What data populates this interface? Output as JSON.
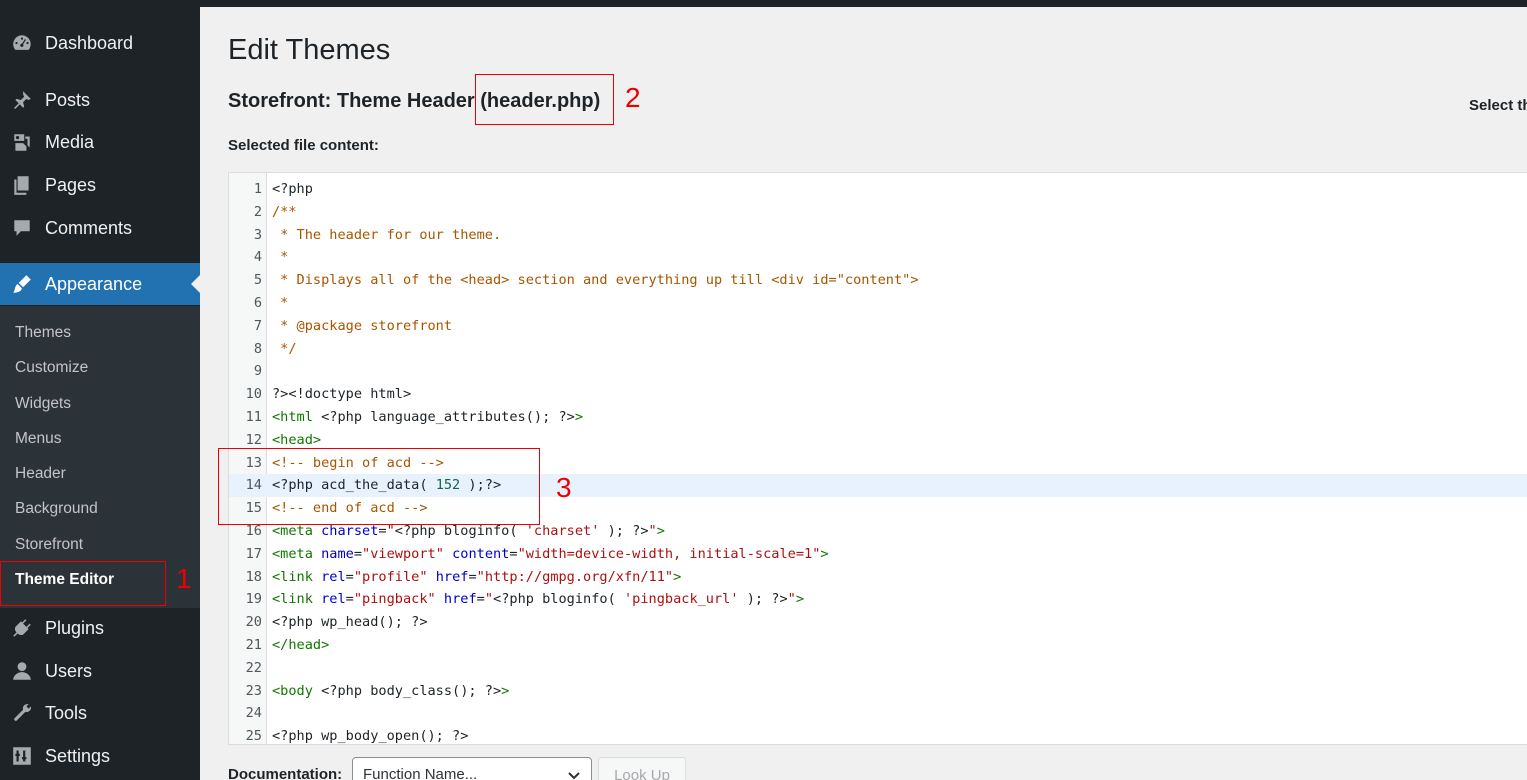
{
  "sidebar": {
    "items": [
      {
        "label": "Dashboard",
        "icon": "dashboard-icon"
      },
      {
        "label": "Posts",
        "icon": "pushpin-icon"
      },
      {
        "label": "Media",
        "icon": "media-icon"
      },
      {
        "label": "Pages",
        "icon": "pages-icon"
      },
      {
        "label": "Comments",
        "icon": "comment-icon"
      },
      {
        "label": "Appearance",
        "icon": "paintbrush-icon"
      },
      {
        "label": "Plugins",
        "icon": "plugin-icon"
      },
      {
        "label": "Users",
        "icon": "user-icon"
      },
      {
        "label": "Tools",
        "icon": "wrench-icon"
      },
      {
        "label": "Settings",
        "icon": "settings-icon"
      }
    ],
    "submenu": [
      "Themes",
      "Customize",
      "Widgets",
      "Menus",
      "Header",
      "Background",
      "Storefront",
      "Theme Editor"
    ]
  },
  "annotations": {
    "one": "1",
    "two": "2",
    "three": "3"
  },
  "main": {
    "page_title": "Edit Themes",
    "file_title": "Storefront: Theme Header (header.php)",
    "select_theme_label": "Select th",
    "selected_file_label": "Selected file content:",
    "doc_label": "Documentation:",
    "doc_select_value": "Function Name...",
    "lookup_label": "Look Up"
  },
  "code_lines": [
    {
      "n": "1",
      "tokens": [
        [
          "def",
          "<?php"
        ]
      ]
    },
    {
      "n": "2",
      "tokens": [
        [
          "cmt",
          "/**"
        ]
      ]
    },
    {
      "n": "3",
      "tokens": [
        [
          "cmt",
          " * The header for our theme."
        ]
      ]
    },
    {
      "n": "4",
      "tokens": [
        [
          "cmt",
          " *"
        ]
      ]
    },
    {
      "n": "5",
      "tokens": [
        [
          "cmt",
          " * Displays all of the <head> section and everything up till <div id=\"content\">"
        ]
      ]
    },
    {
      "n": "6",
      "tokens": [
        [
          "cmt",
          " *"
        ]
      ]
    },
    {
      "n": "7",
      "tokens": [
        [
          "cmt",
          " * @package storefront"
        ]
      ]
    },
    {
      "n": "8",
      "tokens": [
        [
          "cmt",
          " */"
        ]
      ]
    },
    {
      "n": "9",
      "tokens": [
        [
          "def",
          ""
        ]
      ]
    },
    {
      "n": "10",
      "tokens": [
        [
          "def",
          "?><!doctype html>"
        ]
      ]
    },
    {
      "n": "11",
      "tokens": [
        [
          "tag",
          "<html "
        ],
        [
          "def",
          "<?php language_attributes(); ?>"
        ],
        [
          "tag",
          ">"
        ]
      ]
    },
    {
      "n": "12",
      "tokens": [
        [
          "tag",
          "<head>"
        ]
      ]
    },
    {
      "n": "13",
      "tokens": [
        [
          "cmt",
          "<!-- begin of acd -->"
        ]
      ]
    },
    {
      "n": "14",
      "tokens": [
        [
          "def",
          "<?php acd_the_data( "
        ],
        [
          "num",
          "152"
        ],
        [
          "def",
          " );?>"
        ]
      ]
    },
    {
      "n": "15",
      "tokens": [
        [
          "cmt",
          "<!-- end of acd -->"
        ]
      ]
    },
    {
      "n": "16",
      "tokens": [
        [
          "tag",
          "<meta "
        ],
        [
          "attr",
          "charset"
        ],
        [
          "def",
          "="
        ],
        [
          "str",
          "\""
        ],
        [
          "def",
          "<?php bloginfo( "
        ],
        [
          "str",
          "'charset'"
        ],
        [
          "def",
          " ); ?>"
        ],
        [
          "str",
          "\""
        ],
        [
          "tag",
          ">"
        ]
      ]
    },
    {
      "n": "17",
      "tokens": [
        [
          "tag",
          "<meta "
        ],
        [
          "attr",
          "name"
        ],
        [
          "def",
          "="
        ],
        [
          "str",
          "\"viewport\""
        ],
        [
          "def",
          " "
        ],
        [
          "attr",
          "content"
        ],
        [
          "def",
          "="
        ],
        [
          "str",
          "\"width=device-width, initial-scale=1\""
        ],
        [
          "tag",
          ">"
        ]
      ]
    },
    {
      "n": "18",
      "tokens": [
        [
          "tag",
          "<link "
        ],
        [
          "attr",
          "rel"
        ],
        [
          "def",
          "="
        ],
        [
          "str",
          "\"profile\""
        ],
        [
          "def",
          " "
        ],
        [
          "attr",
          "href"
        ],
        [
          "def",
          "="
        ],
        [
          "str",
          "\"http://gmpg.org/xfn/11\""
        ],
        [
          "tag",
          ">"
        ]
      ]
    },
    {
      "n": "19",
      "tokens": [
        [
          "tag",
          "<link "
        ],
        [
          "attr",
          "rel"
        ],
        [
          "def",
          "="
        ],
        [
          "str",
          "\"pingback\""
        ],
        [
          "def",
          " "
        ],
        [
          "attr",
          "href"
        ],
        [
          "def",
          "="
        ],
        [
          "str",
          "\""
        ],
        [
          "def",
          "<?php bloginfo( "
        ],
        [
          "str",
          "'pingback_url'"
        ],
        [
          "def",
          " ); ?>"
        ],
        [
          "str",
          "\""
        ],
        [
          "tag",
          ">"
        ]
      ]
    },
    {
      "n": "20",
      "tokens": [
        [
          "def",
          "<?php wp_head(); ?>"
        ]
      ]
    },
    {
      "n": "21",
      "tokens": [
        [
          "tag",
          "</head>"
        ]
      ]
    },
    {
      "n": "22",
      "tokens": [
        [
          "def",
          ""
        ]
      ]
    },
    {
      "n": "23",
      "tokens": [
        [
          "tag",
          "<body "
        ],
        [
          "def",
          "<?php body_class(); ?>"
        ],
        [
          "tag",
          ">"
        ]
      ]
    },
    {
      "n": "24",
      "tokens": [
        [
          "def",
          ""
        ]
      ]
    },
    {
      "n": "25",
      "tokens": [
        [
          "def",
          "<?php wp_body_open(); ?>"
        ]
      ]
    }
  ]
}
